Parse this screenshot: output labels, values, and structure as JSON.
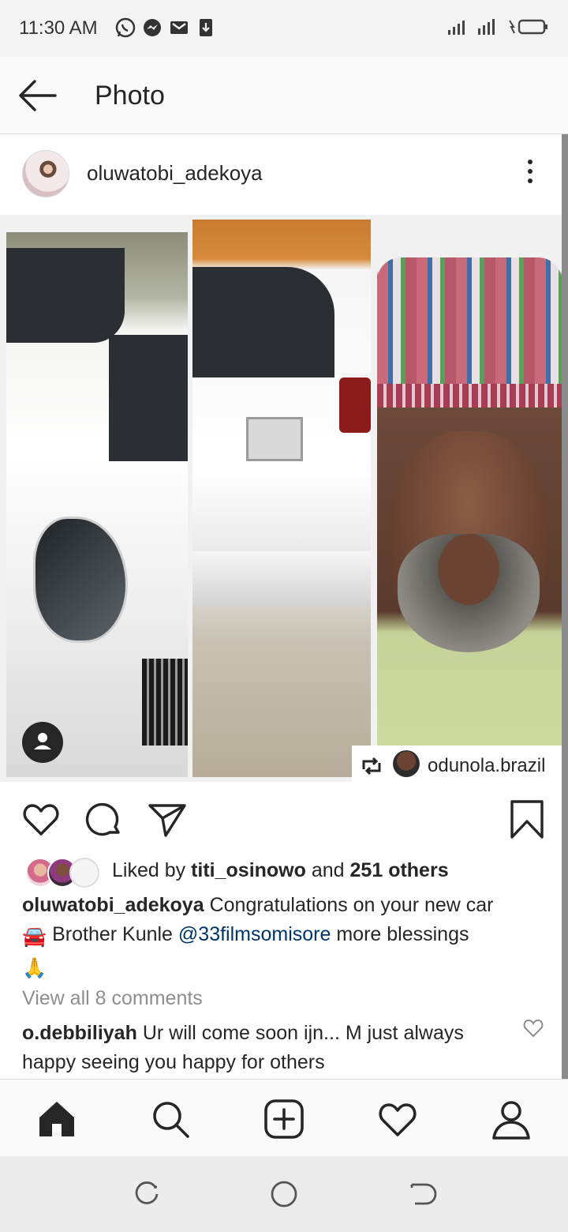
{
  "status_bar": {
    "time": "11:30 AM",
    "left_icons": [
      "whatsapp-icon",
      "messenger-icon",
      "gmail-icon",
      "download-icon"
    ],
    "right_icons": [
      "signal-icon",
      "signal-4g-icon",
      "charging-battery-icon"
    ]
  },
  "header": {
    "title": "Photo",
    "back_icon": "arrow-left-icon"
  },
  "post": {
    "username": "oluwatobi_adekoya",
    "more_icon": "vertical-dots-icon",
    "repost": {
      "icon": "repost-icon",
      "username": "odunola.brazil"
    },
    "tag_icon": "person-tag-icon"
  },
  "actions": {
    "like_icon": "heart-icon",
    "comment_icon": "comment-icon",
    "share_icon": "send-icon",
    "save_icon": "bookmark-icon"
  },
  "likes": {
    "prefix": "Liked by",
    "user": "titi_osinowo",
    "middle": "and",
    "count": "251 others"
  },
  "caption": {
    "username": "oluwatobi_adekoya",
    "text_1": "Congratulations on your new car",
    "car_emoji": "🚘",
    "text_2": "Brother Kunle",
    "mention": "@33filmsomisore",
    "text_3": "more blessings",
    "pray_emoji": "🙏"
  },
  "comments": {
    "view_all": "View all 8 comments",
    "items": [
      {
        "username": "o.debbiliyah",
        "text": "Ur will come soon ijn... M just always happy seeing you happy for others"
      }
    ]
  },
  "bottom_nav": [
    "home-icon",
    "search-icon",
    "add-post-icon",
    "activity-heart-icon",
    "profile-icon"
  ],
  "system_nav": [
    "recent-apps-icon",
    "home-circle-icon",
    "back-icon"
  ],
  "colors": {
    "text": "#262626",
    "muted": "#8e8e8e",
    "mention": "#003569",
    "border": "#dbdbdb"
  }
}
